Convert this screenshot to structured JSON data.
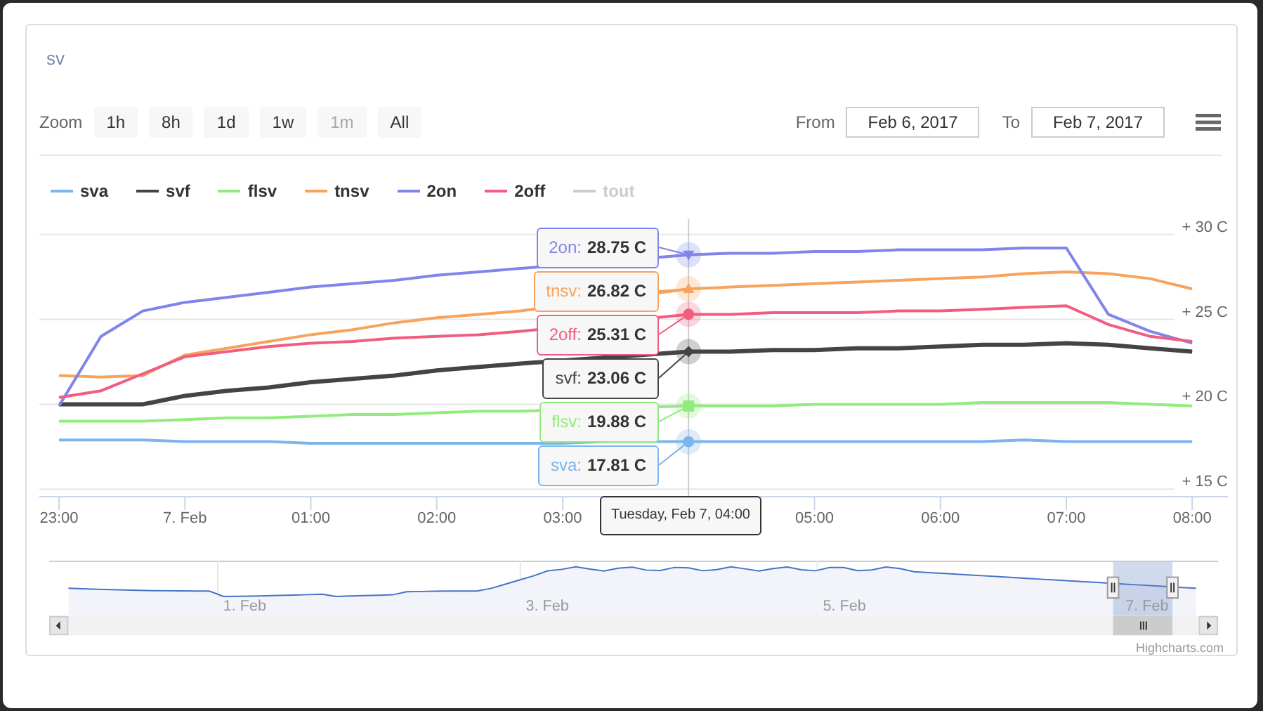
{
  "title": "sv",
  "range_selector": {
    "label": "Zoom",
    "buttons": [
      {
        "label": "1h",
        "disabled": false
      },
      {
        "label": "8h",
        "disabled": false
      },
      {
        "label": "1d",
        "disabled": false
      },
      {
        "label": "1w",
        "disabled": false
      },
      {
        "label": "1m",
        "disabled": true
      },
      {
        "label": "All",
        "disabled": false
      }
    ]
  },
  "date_range": {
    "from_label": "From",
    "from": "Feb 6, 2017",
    "to_label": "To",
    "to": "Feb 7, 2017"
  },
  "legend_hidden": [
    "tout"
  ],
  "chart_data": {
    "type": "line",
    "grid": true,
    "categories": [
      "23:00",
      null,
      null,
      "7. Feb",
      null,
      null,
      "01:00",
      null,
      null,
      "02:00",
      null,
      null,
      "03:00",
      null,
      null,
      null,
      null,
      null,
      "05:00",
      null,
      null,
      "06:00",
      null,
      null,
      "07:00",
      null,
      null,
      "08:00"
    ],
    "ylim": [
      14.6,
      30.9
    ],
    "yticks": [
      {
        "value": 30,
        "label": "+ 30 C"
      },
      {
        "value": 25,
        "label": "+ 25 C"
      },
      {
        "value": 20,
        "label": "+ 20 C"
      },
      {
        "value": 15,
        "label": "+ 15 C"
      }
    ],
    "series": [
      {
        "name": "sva",
        "color": "#7cb5ec",
        "values": [
          17.9,
          17.9,
          17.9,
          17.8,
          17.8,
          17.8,
          17.7,
          17.7,
          17.7,
          17.7,
          17.7,
          17.7,
          17.7,
          17.8,
          17.8,
          17.8,
          17.8,
          17.8,
          17.8,
          17.8,
          17.8,
          17.8,
          17.8,
          17.9,
          17.8,
          17.8,
          17.8,
          17.8
        ]
      },
      {
        "name": "svf",
        "color": "#434348",
        "values": [
          20.0,
          20.0,
          20.0,
          20.5,
          20.8,
          21.0,
          21.3,
          21.5,
          21.7,
          22.0,
          22.2,
          22.4,
          null,
          null,
          null,
          23.1,
          23.1,
          23.2,
          23.2,
          23.3,
          23.3,
          23.4,
          23.5,
          23.5,
          23.6,
          23.5,
          23.3,
          23.1
        ]
      },
      {
        "name": "flsv",
        "color": "#90ed7d",
        "values": [
          19.0,
          19.0,
          19.0,
          19.1,
          19.2,
          19.2,
          19.3,
          19.4,
          19.4,
          19.5,
          19.6,
          19.6,
          null,
          null,
          null,
          19.9,
          19.9,
          19.9,
          20.0,
          20.0,
          20.0,
          20.0,
          20.1,
          20.1,
          20.1,
          20.1,
          20.0,
          19.9
        ]
      },
      {
        "name": "tnsv",
        "color": "#f7a35c",
        "values": [
          21.7,
          21.6,
          21.7,
          22.9,
          23.3,
          23.7,
          24.1,
          24.4,
          24.8,
          25.1,
          25.3,
          25.5,
          null,
          null,
          null,
          26.8,
          26.9,
          27.0,
          27.1,
          27.2,
          27.3,
          27.4,
          27.5,
          27.7,
          27.8,
          27.7,
          27.4,
          26.8
        ]
      },
      {
        "name": "2on",
        "color": "#8085e9",
        "values": [
          19.9,
          24.0,
          25.5,
          26.0,
          26.3,
          26.6,
          26.9,
          27.1,
          27.3,
          27.6,
          27.8,
          28.0,
          null,
          null,
          null,
          28.8,
          28.9,
          28.9,
          29.0,
          29.0,
          29.1,
          29.1,
          29.1,
          29.2,
          29.2,
          25.3,
          24.3,
          23.6
        ]
      },
      {
        "name": "2off",
        "color": "#f15c80",
        "values": [
          20.4,
          20.8,
          21.8,
          22.8,
          23.1,
          23.4,
          23.6,
          23.7,
          23.9,
          24.0,
          24.1,
          24.3,
          null,
          null,
          null,
          25.3,
          25.3,
          25.4,
          25.4,
          25.4,
          25.5,
          25.5,
          25.6,
          25.7,
          25.8,
          24.7,
          24.0,
          23.7
        ]
      }
    ]
  },
  "tooltips": [
    {
      "label": "2on:",
      "value": "28.75 C",
      "color": "#8085e9",
      "kind": "triangle-down"
    },
    {
      "label": "tnsv:",
      "value": "26.82 C",
      "color": "#f7a35c",
      "kind": "triangle"
    },
    {
      "label": "2off:",
      "value": "25.31 C",
      "color": "#f15c80",
      "kind": "circle"
    },
    {
      "label": "svf:",
      "value": "23.06 C",
      "color": "#434348",
      "kind": "diamond"
    },
    {
      "label": "flsv:",
      "value": "19.88 C",
      "color": "#90ed7d",
      "kind": "square"
    },
    {
      "label": "sva:",
      "value": "17.81 C",
      "color": "#7cb5ec",
      "kind": "circle"
    }
  ],
  "date_tooltip": "Tuesday, Feb 7, 04:00",
  "navigator": {
    "labels": [
      "1. Feb",
      "3. Feb",
      "5. Feb",
      "7. Feb"
    ]
  },
  "credits": "Highcharts.com"
}
